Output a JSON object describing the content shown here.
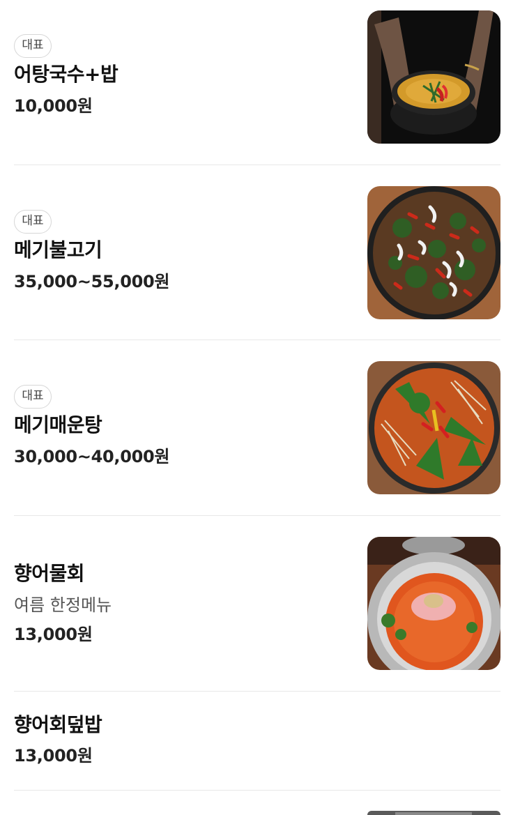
{
  "menu": {
    "items": [
      {
        "badge": "대표",
        "name": "어탕국수+밥",
        "price": "10,000원",
        "image": "fish-noodle-soup-bowl-photo"
      },
      {
        "badge": "대표",
        "name": "메기불고기",
        "price": "35,000~55,000원",
        "image": "catfish-bulgogi-pan-photo"
      },
      {
        "badge": "대표",
        "name": "메기매운탕",
        "price": "30,000~40,000원",
        "image": "spicy-catfish-stew-photo"
      },
      {
        "name": "향어물회",
        "description": "여름 한정메뉴",
        "price": "13,000원",
        "image": "cold-raw-fish-soup-photo"
      },
      {
        "name": "향어회덮밥",
        "price": "13,000원"
      }
    ]
  }
}
